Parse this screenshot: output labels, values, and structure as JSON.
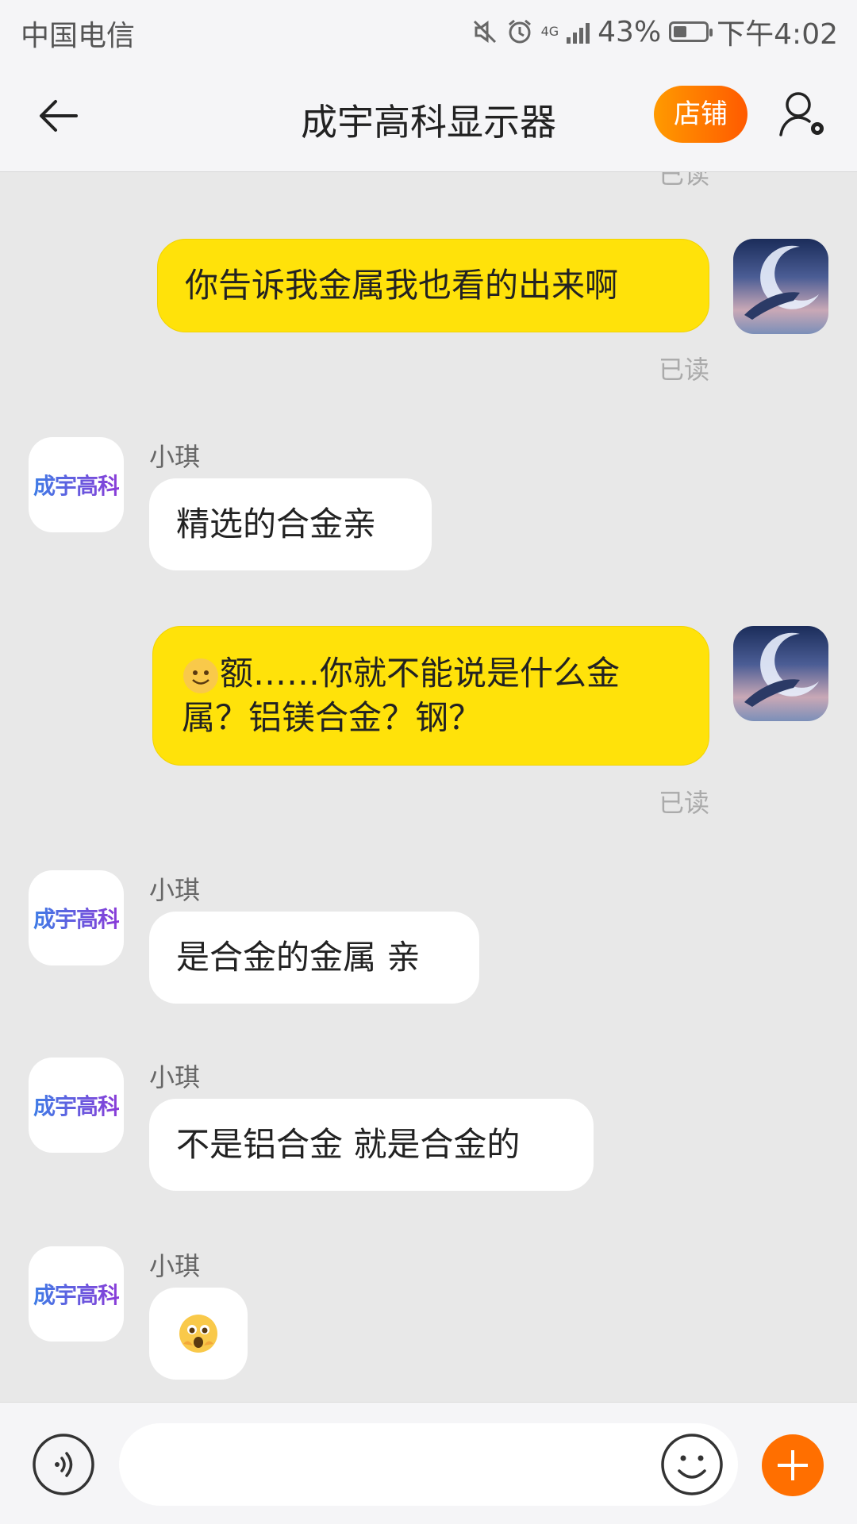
{
  "status_bar": {
    "carrier": "中国电信",
    "network": "4G",
    "battery": "43%",
    "battery_level": 0.43,
    "time": "下午4:02"
  },
  "header": {
    "title": "成宇高科显示器",
    "shop_button": "店铺"
  },
  "shop_avatar_text": "成宇高科",
  "messages": [
    {
      "from": "me",
      "text": "你告诉我金属我也看的出来啊",
      "status": "已读"
    },
    {
      "from": "shop",
      "sender": "小琪",
      "text": "精选的合金亲"
    },
    {
      "from": "me",
      "text_line1": "额……你就不能说是什么金",
      "text_line2": "属？铝镁合金？钢？",
      "emoji": "smile-emoji",
      "status": "已读"
    },
    {
      "from": "shop",
      "sender": "小琪",
      "text": "是合金的金属 亲"
    },
    {
      "from": "shop",
      "sender": "小琪",
      "text": "不是铝合金 就是合金的"
    },
    {
      "from": "shop",
      "sender": "小琪",
      "emoji": "shocked-emoji"
    }
  ],
  "partial_top_status": "已读",
  "input": {
    "placeholder": ""
  },
  "colors": {
    "my_bubble": "#ffe20a",
    "accent": "#ff6f00"
  }
}
